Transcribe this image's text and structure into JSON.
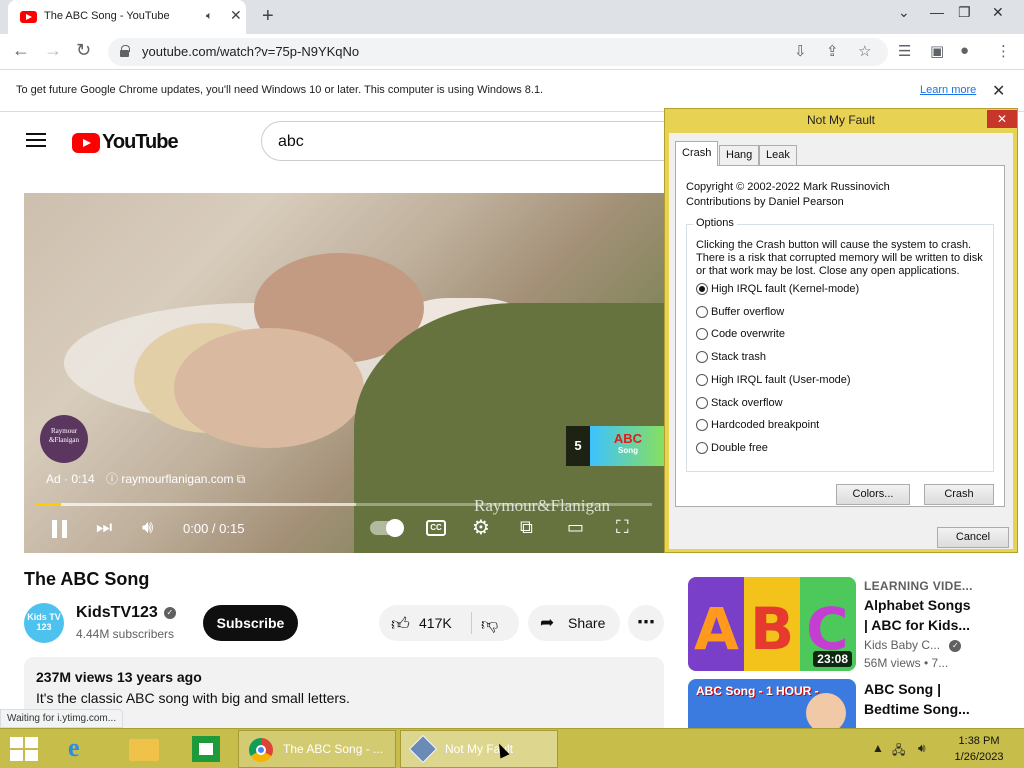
{
  "browser": {
    "tab_title": "The ABC Song - YouTube",
    "url": "youtube.com/watch?v=75p-N9YKqNo",
    "infobar_message": "To get future Google Chrome updates, you'll need Windows 10 or later. This computer is using Windows 8.1.",
    "infobar_link": "Learn more",
    "status_text": "Waiting for i.ytimg.com..."
  },
  "youtube": {
    "logo_text": "YouTube",
    "search_query": "abc",
    "ad": {
      "label": "Ad · 0:14",
      "site": "raymourflanigan.com",
      "badge_text": "Raymour &Flanigan",
      "watermark": "Raymour&Flanigan",
      "skip_count": "5",
      "skip_thumb_title": "ABC",
      "skip_thumb_sub": "Song",
      "progress_fraction": 0.04,
      "buffer_fraction": 0.52
    },
    "player_time": "0:00 / 0:15",
    "video_title": "The ABC Song",
    "channel": {
      "name": "KidsTV123",
      "avatar_text": "Kids TV 123",
      "subscribers": "4.44M subscribers",
      "subscribe_label": "Subscribe"
    },
    "actions": {
      "likes": "417K",
      "share": "Share"
    },
    "description": {
      "meta": "237M views  13 years ago",
      "text": "It's the classic ABC song with big and small letters."
    },
    "recommendations": [
      {
        "eyebrow": "LEARNING VIDE...",
        "title": "Alphabet Songs | ABC for Kids...",
        "channel": "Kids Baby C...",
        "views": "56M views  • 7...",
        "duration": "23:08"
      },
      {
        "title": "ABC Song | Bedtime Song...",
        "thumb_banner": "ABC Song - 1 HOUR -"
      }
    ]
  },
  "dialog": {
    "title": "Not My Fault",
    "tabs": [
      "Crash",
      "Hang",
      "Leak"
    ],
    "copyright": "Copyright © 2002-2022 Mark Russinovich",
    "contributors": "Contributions by Daniel Pearson",
    "options_label": "Options",
    "warning": "Clicking the Crash button will cause the system to crash. There is a risk that corrupted memory will be written to disk or that work may be lost. Close any open applications.",
    "options": [
      "High IRQL fault (Kernel-mode)",
      "Buffer overflow",
      "Code overwrite",
      "Stack trash",
      "High IRQL fault (User-mode)",
      "Stack overflow",
      "Hardcoded breakpoint",
      "Double free"
    ],
    "selected_option": 0,
    "colors_button": "Colors...",
    "crash_button": "Crash",
    "cancel_button": "Cancel"
  },
  "taskbar": {
    "chrome_label": "The ABC Song - ...",
    "nmf_label": "Not My Fault",
    "time": "1:38 PM",
    "date": "1/26/2023"
  }
}
